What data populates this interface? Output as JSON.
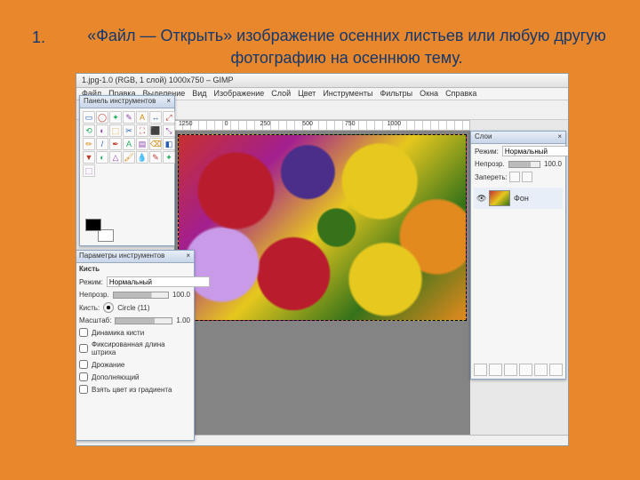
{
  "slide": {
    "number": "1.",
    "title": "«Файл — Открыть» изображение осенних листьев или любую другую фотографию на осеннюю тему."
  },
  "window": {
    "title": "1.jpg-1.0 (RGB, 1 слой) 1000x750 – GIMP"
  },
  "menu": {
    "items": [
      "Файл",
      "Правка",
      "Выделение",
      "Вид",
      "Изображение",
      "Слой",
      "Цвет",
      "Инструменты",
      "Фильтры",
      "Окна",
      "Справка"
    ]
  },
  "ruler": {
    "marks": [
      "1250",
      "0",
      "250",
      "500",
      "750",
      "1000"
    ]
  },
  "toolbox": {
    "title": "Панель инструментов",
    "close": "×",
    "tools": [
      "▭",
      "◯",
      "✦",
      "✎",
      "A",
      "↔",
      "⤢",
      "⟲",
      "◐",
      "⬚",
      "✂",
      "⛶",
      "⬛",
      "⤡",
      "✏",
      "/",
      "✒",
      "A",
      "▤",
      "⌫",
      "◧",
      "▼",
      "◐",
      "△",
      "🖌",
      "💧",
      "✎",
      "✦",
      "⬚"
    ]
  },
  "tooloptions": {
    "title": "Параметры инструментов",
    "brush_lbl": "Кисть",
    "mode_lbl": "Режим:",
    "mode_val": "Нормальный",
    "opacity_lbl": "Непрозр.",
    "opacity_val": "100.0",
    "brushsize_lbl": "Кисть:",
    "brushsize_val": "Circle (11)",
    "scale_lbl": "Масштаб:",
    "scale_val": "1.00",
    "dynamics": "Динамика кисти",
    "fixed": "Фиксированная длина штриха",
    "jitter": "Дрожание",
    "incremental": "Дополняющий",
    "gradient": "Взять цвет из градиента"
  },
  "layers": {
    "title": "Слои",
    "mode_lbl": "Режим:",
    "mode_val": "Нормальный",
    "opacity_lbl": "Непрозр.",
    "opacity_val": "100.0",
    "lock_lbl": "Запереть:",
    "layer_name": "Фон"
  }
}
